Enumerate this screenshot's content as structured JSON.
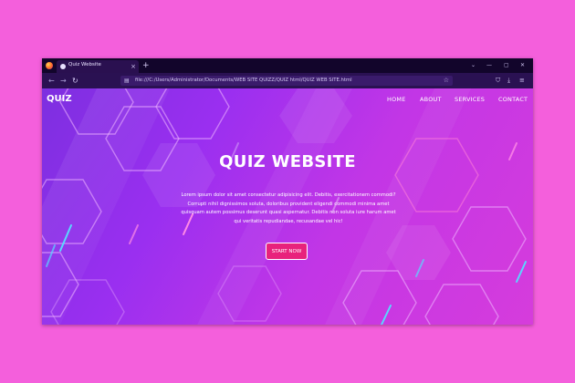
{
  "browser": {
    "tab_title": "Quiz Website",
    "tab_close": "×",
    "new_tab": "+",
    "url": "file:///C:/Users/Administrator/Documents/WEB SITE QUIZZ/QUIZ html/QUIZ WEB SITE.html",
    "window_controls": [
      "⌄",
      "—",
      "▢",
      "✕"
    ],
    "nav_buttons": [
      "←",
      "→",
      "↻"
    ],
    "toolbar_icons": [
      "shield-icon",
      "download-icon",
      "extensions-icon",
      "menu-icon"
    ]
  },
  "site": {
    "logo": "QUIZ",
    "nav": [
      "HOME",
      "ABOUT",
      "SERVICES",
      "CONTACT"
    ],
    "hero_title": "QUIZ WEBSITE",
    "hero_text": "Lorem ipsum dolor sit amet consectetur adipisicing elit. Debitis, exercitationem commodi? Corrupti nihil dignissimos soluta, doloribus provident eligendi commodi minima amet quisquam autem possimus deserunt quasi aspernatur. Debitis non soluta iure harum amet qui veritatis repudiandae, recusandae vel hic!",
    "cta": "START NOW"
  },
  "colors": {
    "outer_background": "#f45fdc",
    "page_gradient_start": "#7d2fe0",
    "page_gradient_end": "#d63cdc",
    "cta_background": "#e8227c",
    "browser_chrome": "#2a1152"
  }
}
